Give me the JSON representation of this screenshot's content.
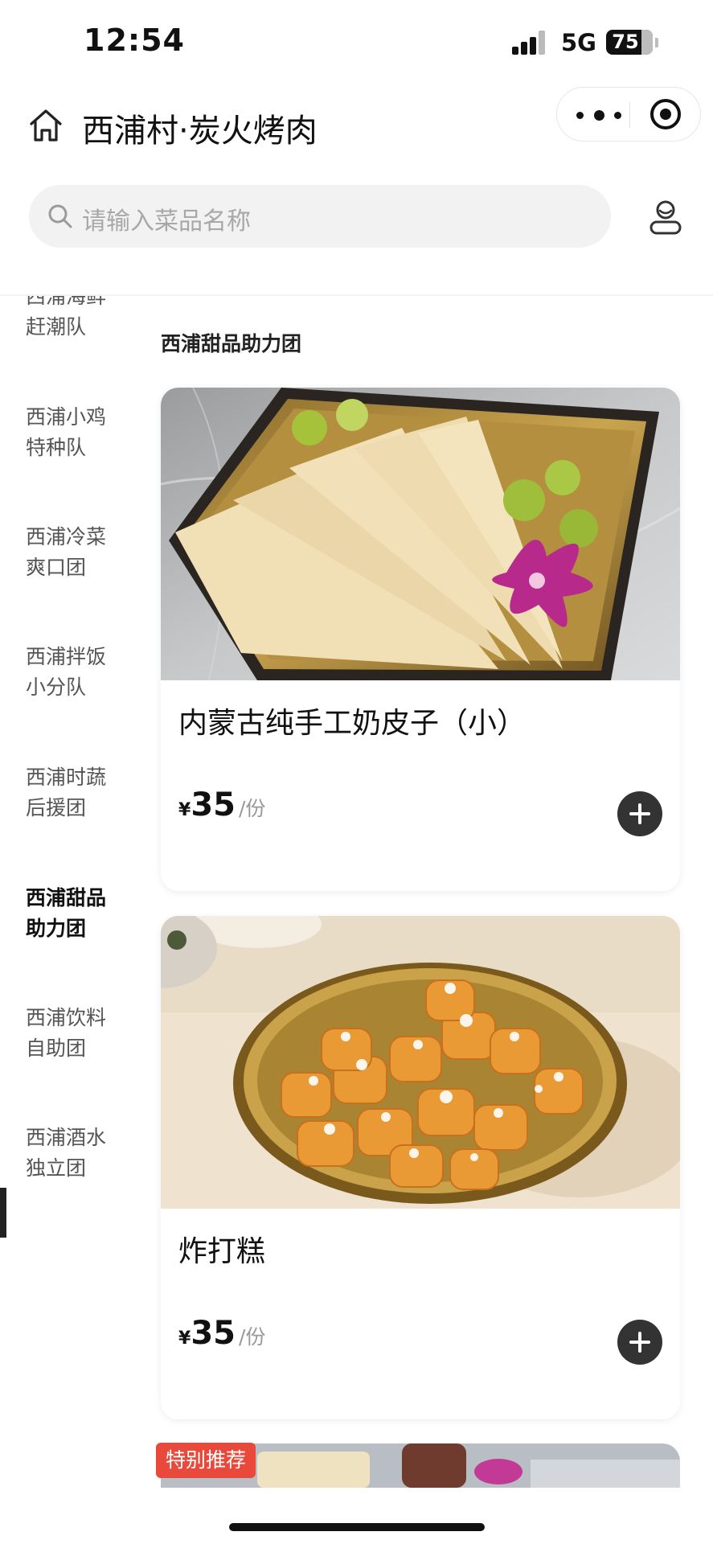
{
  "status_bar": {
    "time": "12:54",
    "network": "5G",
    "battery": "75"
  },
  "header": {
    "store_name": "西浦村·炭火烤肉"
  },
  "search": {
    "placeholder": "请输入菜品名称"
  },
  "sidebar": {
    "categories": [
      {
        "label_line1": "西浦海鲜",
        "label_line2": "赶潮队"
      },
      {
        "label_line1": "西浦小鸡",
        "label_line2": "特种队"
      },
      {
        "label_line1": "西浦冷菜",
        "label_line2": "爽口团"
      },
      {
        "label_line1": "西浦拌饭",
        "label_line2": "小分队"
      },
      {
        "label_line1": "西浦时蔬",
        "label_line2": "后援团"
      },
      {
        "label_line1": "西浦甜品",
        "label_line2": "助力团",
        "active": true
      },
      {
        "label_line1": "西浦饮料",
        "label_line2": "自助团"
      },
      {
        "label_line1": "西浦酒水",
        "label_line2": "独立团"
      }
    ]
  },
  "main": {
    "section_title": "西浦甜品助力团",
    "items": [
      {
        "name": "内蒙古纯手工奶皮子（小）",
        "currency": "¥",
        "price": "35",
        "unit": "/份",
        "image": "milk-skin-dessert-photo"
      },
      {
        "name": "炸打糕",
        "currency": "¥",
        "price": "35",
        "unit": "/份",
        "image": "fried-rice-cake-photo"
      }
    ],
    "next_item_badge": "特别推荐"
  },
  "colors": {
    "accent_dark": "#333333",
    "badge_red": "#e8493b",
    "search_bg": "#f2f2f2"
  }
}
